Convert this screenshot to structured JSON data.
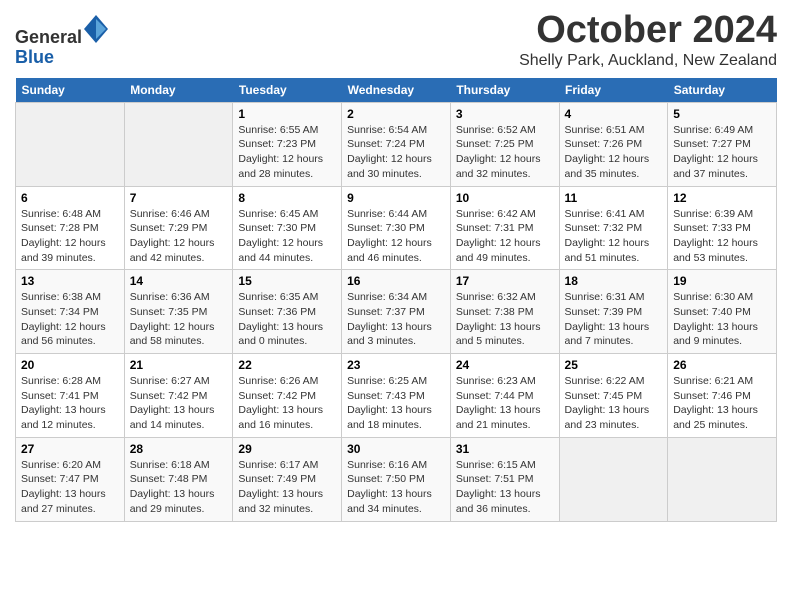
{
  "header": {
    "logo_line1": "General",
    "logo_line2": "Blue",
    "month_title": "October 2024",
    "location": "Shelly Park, Auckland, New Zealand"
  },
  "weekdays": [
    "Sunday",
    "Monday",
    "Tuesday",
    "Wednesday",
    "Thursday",
    "Friday",
    "Saturday"
  ],
  "weeks": [
    [
      {
        "day": "",
        "info": ""
      },
      {
        "day": "",
        "info": ""
      },
      {
        "day": "1",
        "info": "Sunrise: 6:55 AM\nSunset: 7:23 PM\nDaylight: 12 hours\nand 28 minutes."
      },
      {
        "day": "2",
        "info": "Sunrise: 6:54 AM\nSunset: 7:24 PM\nDaylight: 12 hours\nand 30 minutes."
      },
      {
        "day": "3",
        "info": "Sunrise: 6:52 AM\nSunset: 7:25 PM\nDaylight: 12 hours\nand 32 minutes."
      },
      {
        "day": "4",
        "info": "Sunrise: 6:51 AM\nSunset: 7:26 PM\nDaylight: 12 hours\nand 35 minutes."
      },
      {
        "day": "5",
        "info": "Sunrise: 6:49 AM\nSunset: 7:27 PM\nDaylight: 12 hours\nand 37 minutes."
      }
    ],
    [
      {
        "day": "6",
        "info": "Sunrise: 6:48 AM\nSunset: 7:28 PM\nDaylight: 12 hours\nand 39 minutes."
      },
      {
        "day": "7",
        "info": "Sunrise: 6:46 AM\nSunset: 7:29 PM\nDaylight: 12 hours\nand 42 minutes."
      },
      {
        "day": "8",
        "info": "Sunrise: 6:45 AM\nSunset: 7:30 PM\nDaylight: 12 hours\nand 44 minutes."
      },
      {
        "day": "9",
        "info": "Sunrise: 6:44 AM\nSunset: 7:30 PM\nDaylight: 12 hours\nand 46 minutes."
      },
      {
        "day": "10",
        "info": "Sunrise: 6:42 AM\nSunset: 7:31 PM\nDaylight: 12 hours\nand 49 minutes."
      },
      {
        "day": "11",
        "info": "Sunrise: 6:41 AM\nSunset: 7:32 PM\nDaylight: 12 hours\nand 51 minutes."
      },
      {
        "day": "12",
        "info": "Sunrise: 6:39 AM\nSunset: 7:33 PM\nDaylight: 12 hours\nand 53 minutes."
      }
    ],
    [
      {
        "day": "13",
        "info": "Sunrise: 6:38 AM\nSunset: 7:34 PM\nDaylight: 12 hours\nand 56 minutes."
      },
      {
        "day": "14",
        "info": "Sunrise: 6:36 AM\nSunset: 7:35 PM\nDaylight: 12 hours\nand 58 minutes."
      },
      {
        "day": "15",
        "info": "Sunrise: 6:35 AM\nSunset: 7:36 PM\nDaylight: 13 hours\nand 0 minutes."
      },
      {
        "day": "16",
        "info": "Sunrise: 6:34 AM\nSunset: 7:37 PM\nDaylight: 13 hours\nand 3 minutes."
      },
      {
        "day": "17",
        "info": "Sunrise: 6:32 AM\nSunset: 7:38 PM\nDaylight: 13 hours\nand 5 minutes."
      },
      {
        "day": "18",
        "info": "Sunrise: 6:31 AM\nSunset: 7:39 PM\nDaylight: 13 hours\nand 7 minutes."
      },
      {
        "day": "19",
        "info": "Sunrise: 6:30 AM\nSunset: 7:40 PM\nDaylight: 13 hours\nand 9 minutes."
      }
    ],
    [
      {
        "day": "20",
        "info": "Sunrise: 6:28 AM\nSunset: 7:41 PM\nDaylight: 13 hours\nand 12 minutes."
      },
      {
        "day": "21",
        "info": "Sunrise: 6:27 AM\nSunset: 7:42 PM\nDaylight: 13 hours\nand 14 minutes."
      },
      {
        "day": "22",
        "info": "Sunrise: 6:26 AM\nSunset: 7:42 PM\nDaylight: 13 hours\nand 16 minutes."
      },
      {
        "day": "23",
        "info": "Sunrise: 6:25 AM\nSunset: 7:43 PM\nDaylight: 13 hours\nand 18 minutes."
      },
      {
        "day": "24",
        "info": "Sunrise: 6:23 AM\nSunset: 7:44 PM\nDaylight: 13 hours\nand 21 minutes."
      },
      {
        "day": "25",
        "info": "Sunrise: 6:22 AM\nSunset: 7:45 PM\nDaylight: 13 hours\nand 23 minutes."
      },
      {
        "day": "26",
        "info": "Sunrise: 6:21 AM\nSunset: 7:46 PM\nDaylight: 13 hours\nand 25 minutes."
      }
    ],
    [
      {
        "day": "27",
        "info": "Sunrise: 6:20 AM\nSunset: 7:47 PM\nDaylight: 13 hours\nand 27 minutes."
      },
      {
        "day": "28",
        "info": "Sunrise: 6:18 AM\nSunset: 7:48 PM\nDaylight: 13 hours\nand 29 minutes."
      },
      {
        "day": "29",
        "info": "Sunrise: 6:17 AM\nSunset: 7:49 PM\nDaylight: 13 hours\nand 32 minutes."
      },
      {
        "day": "30",
        "info": "Sunrise: 6:16 AM\nSunset: 7:50 PM\nDaylight: 13 hours\nand 34 minutes."
      },
      {
        "day": "31",
        "info": "Sunrise: 6:15 AM\nSunset: 7:51 PM\nDaylight: 13 hours\nand 36 minutes."
      },
      {
        "day": "",
        "info": ""
      },
      {
        "day": "",
        "info": ""
      }
    ]
  ]
}
